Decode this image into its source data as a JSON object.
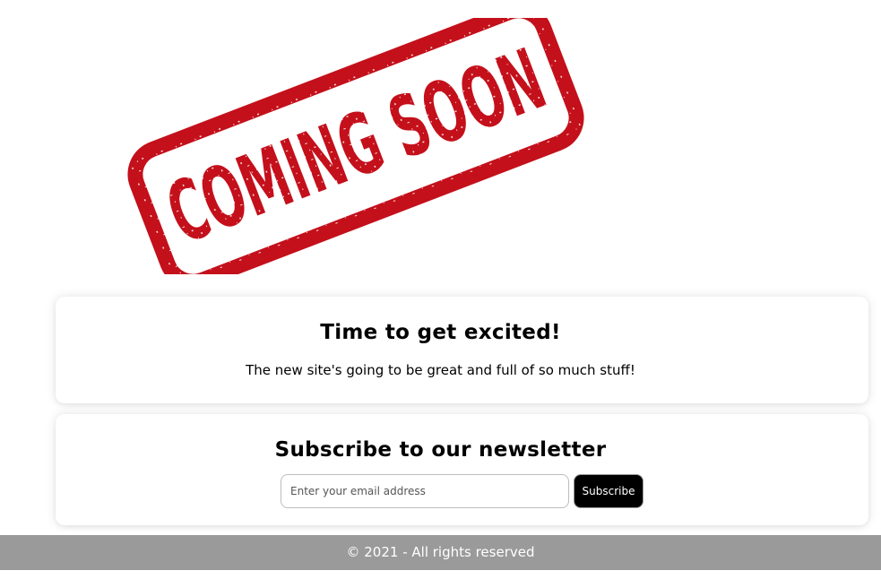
{
  "stamp": {
    "text": "COMING SOON",
    "color": "#c4101b"
  },
  "hero": {
    "title": "Time to get excited!",
    "subtitle": "The new site's going to be great and full of so much stuff!"
  },
  "newsletter": {
    "title": "Subscribe to our newsletter",
    "email_placeholder": "Enter your email address",
    "email_value": "",
    "button_label": "Subscribe"
  },
  "footer": {
    "text": "© 2021 - All rights reserved",
    "background": "#9a9a9a"
  }
}
